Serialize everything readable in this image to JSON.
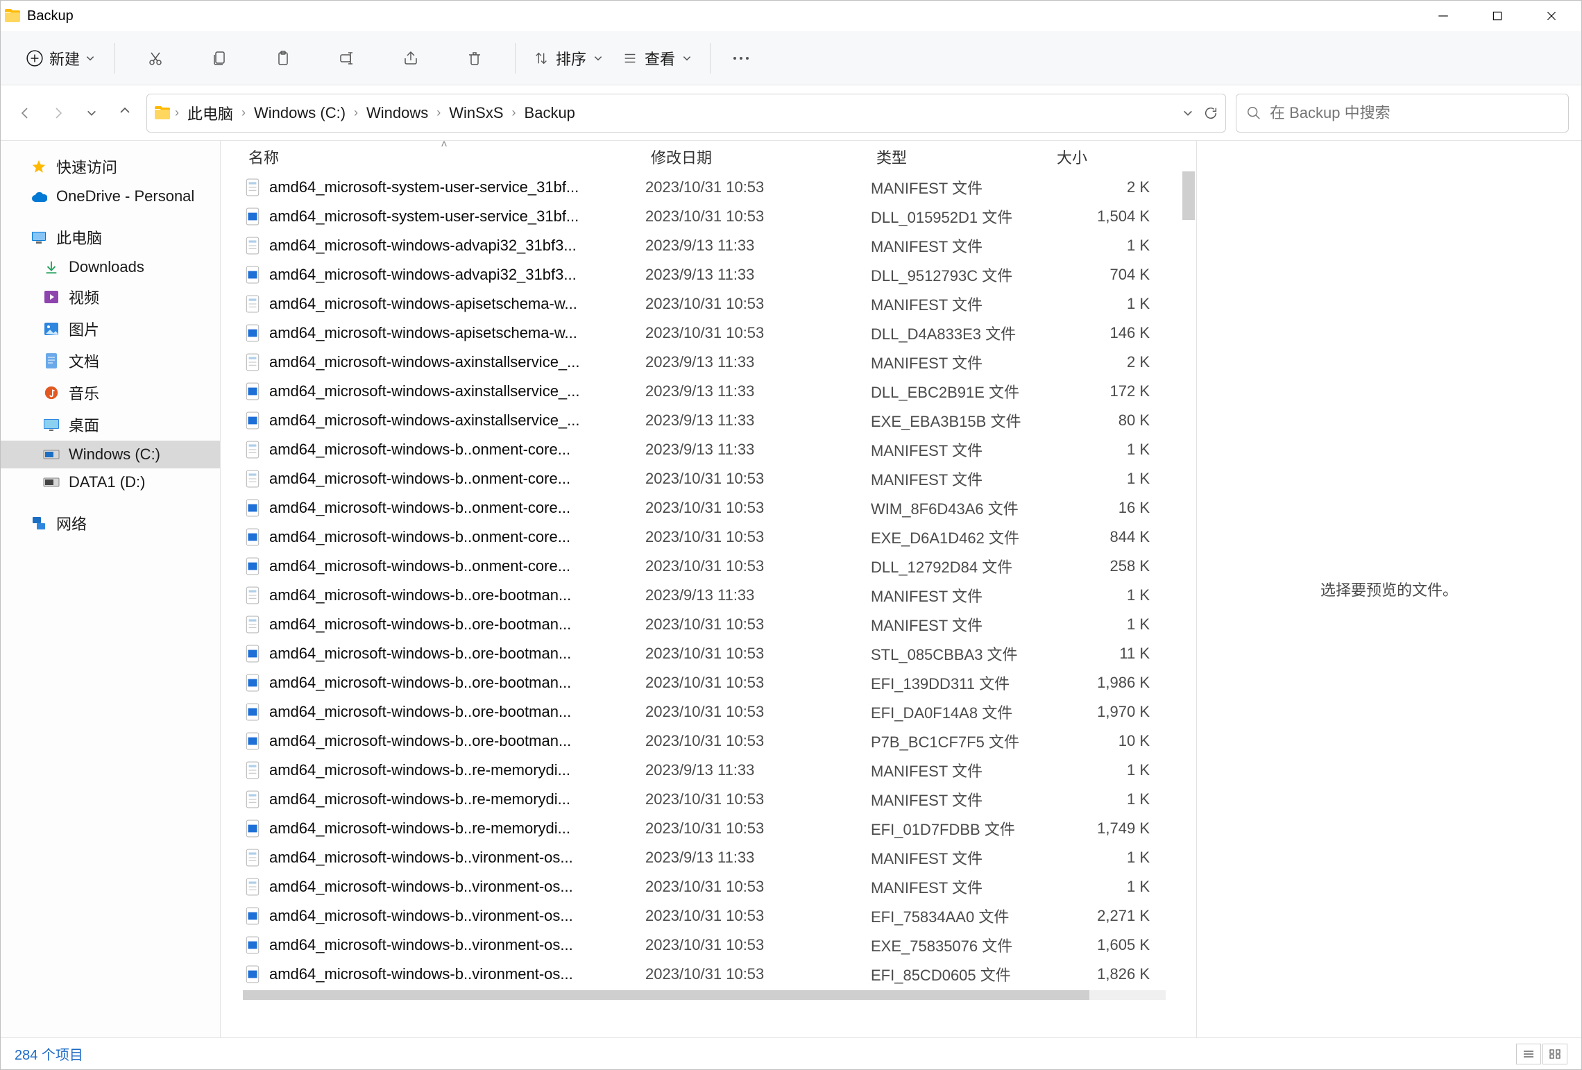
{
  "window": {
    "title": "Backup"
  },
  "toolbar": {
    "new_label": "新建",
    "sort_label": "排序",
    "view_label": "查看"
  },
  "breadcrumbs": [
    "此电脑",
    "Windows (C:)",
    "Windows",
    "WinSxS",
    "Backup"
  ],
  "search": {
    "placeholder": "在 Backup 中搜索"
  },
  "sidebar": {
    "items": [
      {
        "label": "快速访问",
        "icon": "star",
        "color": "#ffb900",
        "level": 1
      },
      {
        "label": "OneDrive - Personal",
        "icon": "cloud",
        "color": "#0078d4",
        "level": 1
      },
      {
        "spacer": true
      },
      {
        "label": "此电脑",
        "icon": "pc",
        "color": "#0078d4",
        "level": 1
      },
      {
        "label": "Downloads",
        "icon": "download",
        "color": "#1fa05a",
        "level": 2
      },
      {
        "label": "视频",
        "icon": "video",
        "color": "#8e44ad",
        "level": 2
      },
      {
        "label": "图片",
        "icon": "picture",
        "color": "#2e86de",
        "level": 2
      },
      {
        "label": "文档",
        "icon": "doc",
        "color": "#6aa9e9",
        "level": 2
      },
      {
        "label": "音乐",
        "icon": "music",
        "color": "#e25822",
        "level": 2
      },
      {
        "label": "桌面",
        "icon": "desktop",
        "color": "#2e86de",
        "level": 2
      },
      {
        "label": "Windows (C:)",
        "icon": "drive",
        "color": "#1b6ec2",
        "level": 2,
        "selected": true
      },
      {
        "label": "DATA1 (D:)",
        "icon": "drive",
        "color": "#444",
        "level": 2
      },
      {
        "spacer": true
      },
      {
        "label": "网络",
        "icon": "network",
        "color": "#1b6ec2",
        "level": 1
      }
    ]
  },
  "columns": {
    "name": "名称",
    "date": "修改日期",
    "type": "类型",
    "size": "大小"
  },
  "files": [
    {
      "name": "amd64_microsoft-system-user-service_31bf...",
      "date": "2023/10/31 10:53",
      "type": "MANIFEST 文件",
      "size": "2 K",
      "icon": "manifest"
    },
    {
      "name": "amd64_microsoft-system-user-service_31bf...",
      "date": "2023/10/31 10:53",
      "type": "DLL_015952D1 文件",
      "size": "1,504 K",
      "icon": "bin"
    },
    {
      "name": "amd64_microsoft-windows-advapi32_31bf3...",
      "date": "2023/9/13 11:33",
      "type": "MANIFEST 文件",
      "size": "1 K",
      "icon": "manifest"
    },
    {
      "name": "amd64_microsoft-windows-advapi32_31bf3...",
      "date": "2023/9/13 11:33",
      "type": "DLL_9512793C 文件",
      "size": "704 K",
      "icon": "bin"
    },
    {
      "name": "amd64_microsoft-windows-apisetschema-w...",
      "date": "2023/10/31 10:53",
      "type": "MANIFEST 文件",
      "size": "1 K",
      "icon": "manifest"
    },
    {
      "name": "amd64_microsoft-windows-apisetschema-w...",
      "date": "2023/10/31 10:53",
      "type": "DLL_D4A833E3 文件",
      "size": "146 K",
      "icon": "bin"
    },
    {
      "name": "amd64_microsoft-windows-axinstallservice_...",
      "date": "2023/9/13 11:33",
      "type": "MANIFEST 文件",
      "size": "2 K",
      "icon": "manifest"
    },
    {
      "name": "amd64_microsoft-windows-axinstallservice_...",
      "date": "2023/9/13 11:33",
      "type": "DLL_EBC2B91E 文件",
      "size": "172 K",
      "icon": "bin"
    },
    {
      "name": "amd64_microsoft-windows-axinstallservice_...",
      "date": "2023/9/13 11:33",
      "type": "EXE_EBA3B15B 文件",
      "size": "80 K",
      "icon": "bin"
    },
    {
      "name": "amd64_microsoft-windows-b..onment-core...",
      "date": "2023/9/13 11:33",
      "type": "MANIFEST 文件",
      "size": "1 K",
      "icon": "manifest"
    },
    {
      "name": "amd64_microsoft-windows-b..onment-core...",
      "date": "2023/10/31 10:53",
      "type": "MANIFEST 文件",
      "size": "1 K",
      "icon": "manifest"
    },
    {
      "name": "amd64_microsoft-windows-b..onment-core...",
      "date": "2023/10/31 10:53",
      "type": "WIM_8F6D43A6 文件",
      "size": "16 K",
      "icon": "bin"
    },
    {
      "name": "amd64_microsoft-windows-b..onment-core...",
      "date": "2023/10/31 10:53",
      "type": "EXE_D6A1D462 文件",
      "size": "844 K",
      "icon": "bin"
    },
    {
      "name": "amd64_microsoft-windows-b..onment-core...",
      "date": "2023/10/31 10:53",
      "type": "DLL_12792D84 文件",
      "size": "258 K",
      "icon": "bin"
    },
    {
      "name": "amd64_microsoft-windows-b..ore-bootman...",
      "date": "2023/9/13 11:33",
      "type": "MANIFEST 文件",
      "size": "1 K",
      "icon": "manifest"
    },
    {
      "name": "amd64_microsoft-windows-b..ore-bootman...",
      "date": "2023/10/31 10:53",
      "type": "MANIFEST 文件",
      "size": "1 K",
      "icon": "manifest"
    },
    {
      "name": "amd64_microsoft-windows-b..ore-bootman...",
      "date": "2023/10/31 10:53",
      "type": "STL_085CBBA3 文件",
      "size": "11 K",
      "icon": "bin"
    },
    {
      "name": "amd64_microsoft-windows-b..ore-bootman...",
      "date": "2023/10/31 10:53",
      "type": "EFI_139DD311 文件",
      "size": "1,986 K",
      "icon": "bin"
    },
    {
      "name": "amd64_microsoft-windows-b..ore-bootman...",
      "date": "2023/10/31 10:53",
      "type": "EFI_DA0F14A8 文件",
      "size": "1,970 K",
      "icon": "bin"
    },
    {
      "name": "amd64_microsoft-windows-b..ore-bootman...",
      "date": "2023/10/31 10:53",
      "type": "P7B_BC1CF7F5 文件",
      "size": "10 K",
      "icon": "bin"
    },
    {
      "name": "amd64_microsoft-windows-b..re-memorydi...",
      "date": "2023/9/13 11:33",
      "type": "MANIFEST 文件",
      "size": "1 K",
      "icon": "manifest"
    },
    {
      "name": "amd64_microsoft-windows-b..re-memorydi...",
      "date": "2023/10/31 10:53",
      "type": "MANIFEST 文件",
      "size": "1 K",
      "icon": "manifest"
    },
    {
      "name": "amd64_microsoft-windows-b..re-memorydi...",
      "date": "2023/10/31 10:53",
      "type": "EFI_01D7FDBB 文件",
      "size": "1,749 K",
      "icon": "bin"
    },
    {
      "name": "amd64_microsoft-windows-b..vironment-os...",
      "date": "2023/9/13 11:33",
      "type": "MANIFEST 文件",
      "size": "1 K",
      "icon": "manifest"
    },
    {
      "name": "amd64_microsoft-windows-b..vironment-os...",
      "date": "2023/10/31 10:53",
      "type": "MANIFEST 文件",
      "size": "1 K",
      "icon": "manifest"
    },
    {
      "name": "amd64_microsoft-windows-b..vironment-os...",
      "date": "2023/10/31 10:53",
      "type": "EFI_75834AA0 文件",
      "size": "2,271 K",
      "icon": "bin"
    },
    {
      "name": "amd64_microsoft-windows-b..vironment-os...",
      "date": "2023/10/31 10:53",
      "type": "EXE_75835076 文件",
      "size": "1,605 K",
      "icon": "bin"
    },
    {
      "name": "amd64_microsoft-windows-b..vironment-os...",
      "date": "2023/10/31 10:53",
      "type": "EFI_85CD0605 文件",
      "size": "1,826 K",
      "icon": "bin"
    }
  ],
  "preview": {
    "empty_text": "选择要预览的文件。"
  },
  "status": {
    "item_count": "284 个项目"
  }
}
